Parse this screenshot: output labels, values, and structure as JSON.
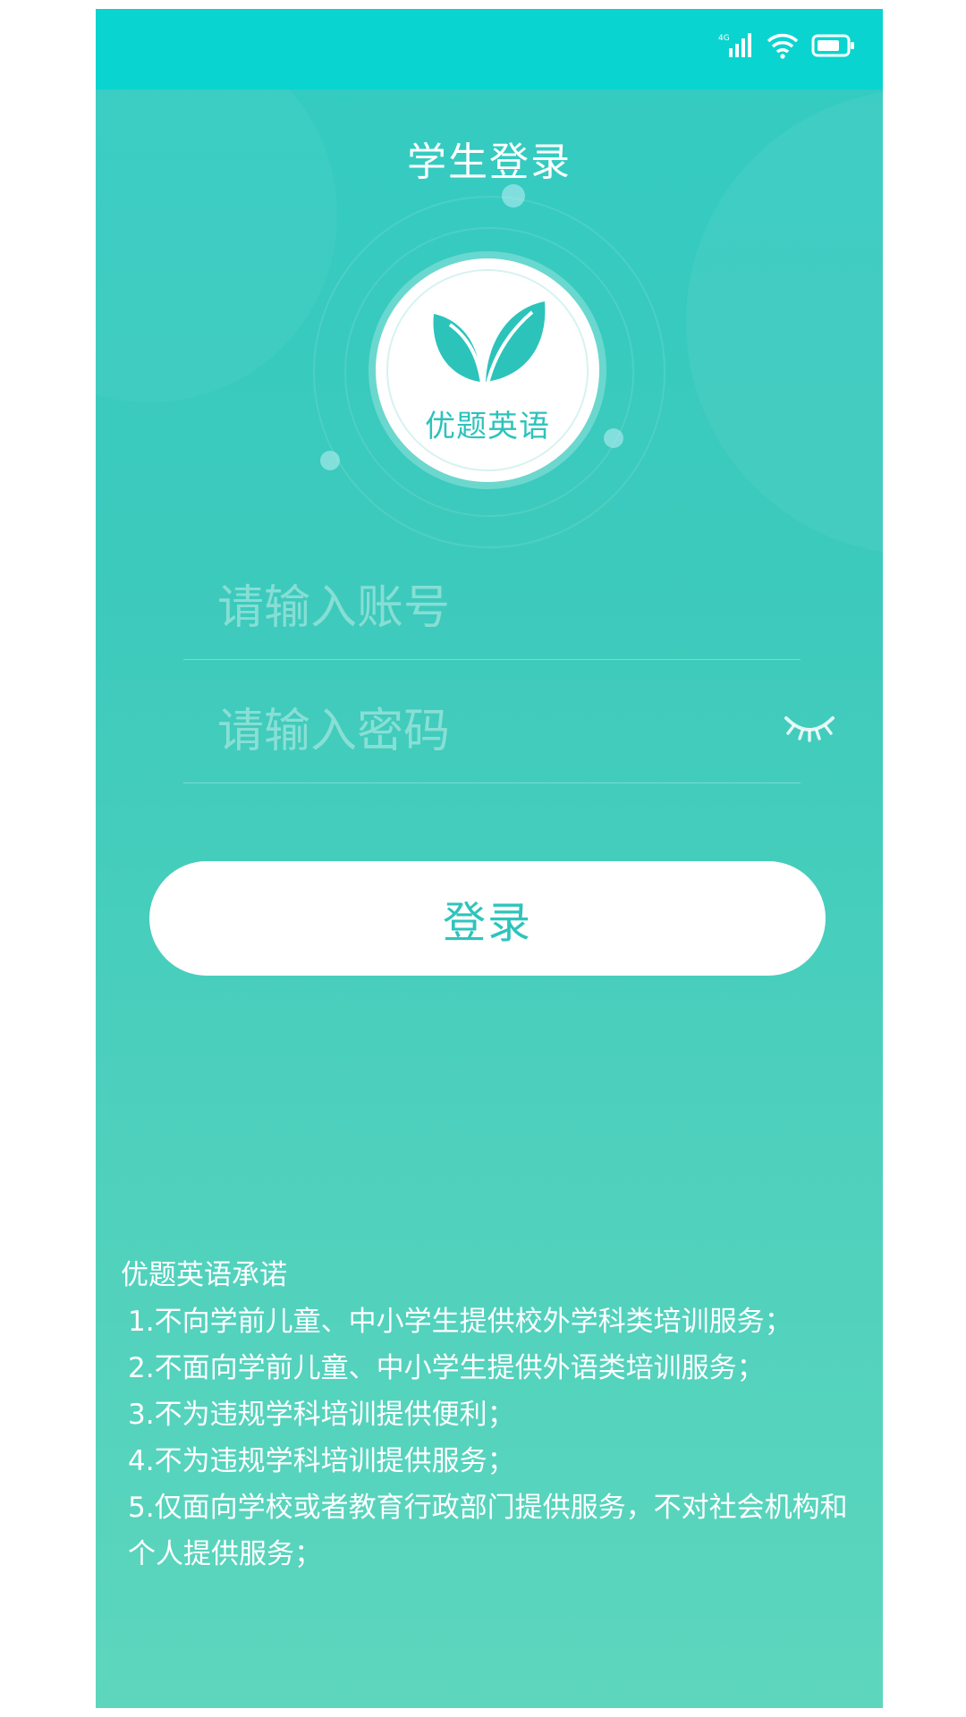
{
  "status_bar": {
    "network": "4G",
    "icons": [
      "signal-icon",
      "wifi-icon",
      "battery-icon"
    ]
  },
  "header": {
    "title": "学生登录"
  },
  "logo": {
    "icon": "leaf-icon",
    "text": "优题英语"
  },
  "form": {
    "account_placeholder": "请输入账号",
    "password_placeholder": "请输入密码",
    "password_toggle_icon": "eye-closed-icon",
    "login_label": "登录"
  },
  "promise": {
    "title": "优题英语承诺",
    "items": [
      "1.不向学前儿童、中小学生提供校外学科类培训服务；",
      "2.不面向学前儿童、中小学生提供外语类培训服务；",
      "3.不为违规学科培训提供便利；",
      "4.不为违规学科培训提供服务；",
      "5.仅面向学校或者教育行政部门提供服务，不对社会机构和个人提供服务；"
    ]
  },
  "colors": {
    "status_bar": "#0ad4cf",
    "accent": "#2ec4bc",
    "background_top": "#33cbc2",
    "background_bottom": "#5dd6bd"
  }
}
